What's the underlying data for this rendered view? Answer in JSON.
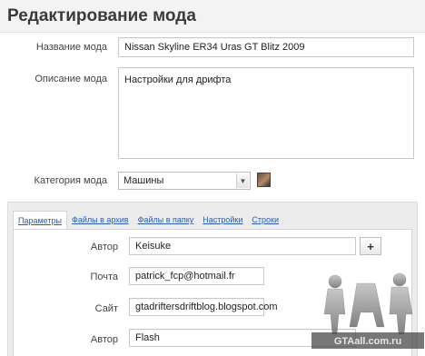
{
  "page": {
    "title": "Редактирование мода"
  },
  "form": {
    "name_label": "Название мода",
    "name_value": "Nissan Skyline ER34 Uras GT Blitz 2009",
    "description_label": "Описание мода",
    "description_value": "Настройки для дрифта",
    "category_label": "Категория мода",
    "category_value": "Машины"
  },
  "tabs": [
    {
      "label": "Параметры",
      "active": true
    },
    {
      "label": "Файлы в архив",
      "active": false
    },
    {
      "label": "Файлы в папку",
      "active": false
    },
    {
      "label": "Настройки",
      "active": false
    },
    {
      "label": "Строки",
      "active": false
    }
  ],
  "params": {
    "author_label": "Автор",
    "author_value": "Keisuke",
    "add_button": "+",
    "email_label": "Почта",
    "email_value": "patrick_fcp@hotmail.fr",
    "site_label": "Сайт",
    "site_value": "gtadriftersdriftblog.blogspot.com",
    "author2_label": "Автор",
    "author2_value": "Flash"
  },
  "watermark": {
    "text": "GTAall.com.ru"
  },
  "icons": {
    "select_arrow": "chevron-down-icon",
    "category_image": "category-thumbnail",
    "add": "plus-icon"
  },
  "colors": {
    "link": "#2a5db0",
    "title_bar": "#f3f3f3",
    "panel": "#ececec",
    "border": "#c9c9c9"
  }
}
